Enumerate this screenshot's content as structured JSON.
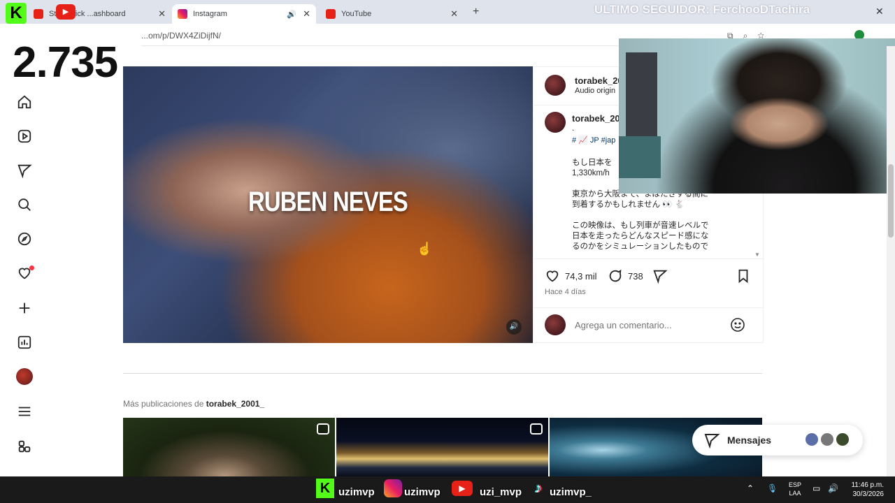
{
  "tabs": [
    {
      "label": "Str... ...tick ...ashboard",
      "active": false
    },
    {
      "label": "Instagram",
      "active": true
    },
    {
      "label": "YouTube",
      "active": false
    }
  ],
  "address": {
    "url": "...om/p/DWX4ZiDijfN/"
  },
  "overlay": {
    "counter": "2.735",
    "kick_logo": "K",
    "follower_banner": "ULTIMO SEGUIDOR: FerchooDTachira"
  },
  "post": {
    "media_title": "RUBEN NEVES",
    "author": "torabek_20",
    "audio": "Audio origin",
    "caption_author": "torabek_20",
    "caption_dot": ".",
    "hashtags": "# 📈 JP #jap",
    "caption_lines": [
      "もし日本を",
      "1,330km/h",
      "",
      "東京から大阪まで、まばたきする間に",
      "到着するかもしれません 👀 🐇",
      "",
      "この映像は、もし列車が音速レベルで",
      "日本を走ったらどんなスピード感にな",
      "るのかをシミュレーションしたもので"
    ],
    "likes": "74,3 mil",
    "comments": "738",
    "time_ago": "Hace 4 días",
    "comment_placeholder": "Agrega un comentario..."
  },
  "more": {
    "prefix": "Más publicaciones de ",
    "author": "torabek_2001_"
  },
  "messages": {
    "label": "Mensajes"
  },
  "taskbar": {
    "labels": [
      "uzimvp",
      "uzimvp",
      "uzi_mvp",
      "uzimvp_"
    ],
    "lang_top": "ESP",
    "lang_bottom": "LAA",
    "time": "11:46 p.m.",
    "date": "30/3/2026"
  }
}
